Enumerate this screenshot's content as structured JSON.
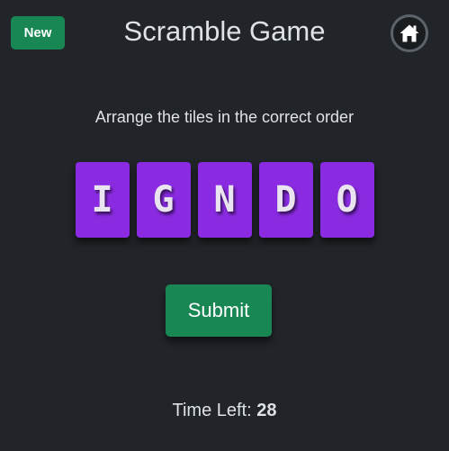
{
  "header": {
    "new_label": "New",
    "title": "Scramble Game",
    "home_icon": "home-icon"
  },
  "game": {
    "instructions": "Arrange the tiles in the correct order",
    "tiles": [
      "I",
      "G",
      "N",
      "D",
      "O"
    ],
    "submit_label": "Submit",
    "timer_label": "Time Left:",
    "timer_value": "28"
  },
  "colors": {
    "background": "#212529",
    "tile": "#8a2be2",
    "button_green": "#198754"
  }
}
